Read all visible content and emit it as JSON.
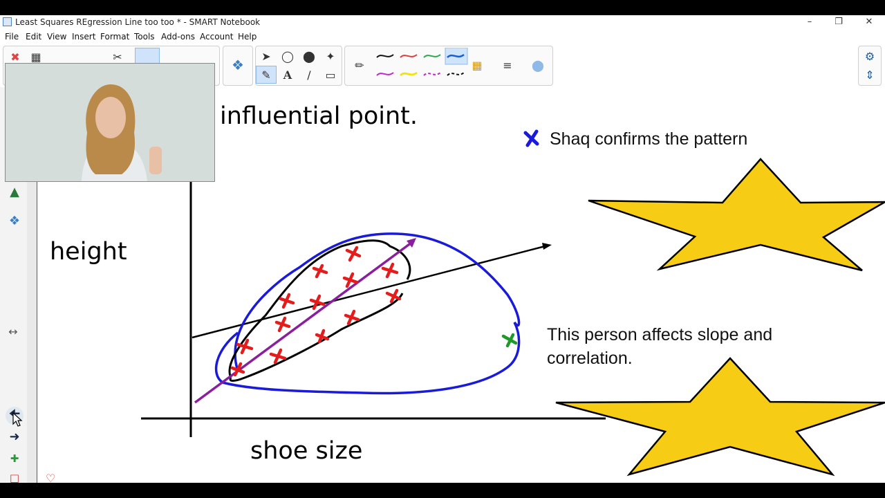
{
  "window": {
    "title": "Least Squares REgression Line  too too * - SMART Notebook",
    "controls": [
      "minimize",
      "restore",
      "close"
    ]
  },
  "menu": {
    "items": [
      "File",
      "Edit",
      "View",
      "Insert",
      "Format",
      "Tools",
      "Add-ons",
      "Account",
      "Help"
    ]
  },
  "toolbar": {
    "tools": [
      "select-icon",
      "shapes-icon",
      "fill-icon",
      "magic-pen-icon",
      "text-icon",
      "line-icon",
      "eraser-icon"
    ],
    "pen_colors": [
      "#111111",
      "#e03a3a",
      "#2aa84a",
      "#1a5fd0",
      "#c026c9",
      "#f2e21a",
      "#c026c9",
      "#111111"
    ],
    "right_icons": [
      "settings-icon",
      "move-toolbar-icon"
    ]
  },
  "sidebar": {
    "icons": [
      "gallery-icon",
      "addons-icon",
      "expand-icon",
      "back-arrow-icon",
      "forward-arrow-icon",
      "add-page-icon",
      "delete-page-icon"
    ]
  },
  "slide": {
    "heading": "influential point.",
    "y_label": "height",
    "x_label": "shoe size",
    "legend_text": "Shaq confirms the pattern",
    "note_text_line1": "This person affects slope and",
    "note_text_line2": "correlation.",
    "colors": {
      "marks": "#e51c1c",
      "outer_loop": "#1a1adb",
      "inner_loop": "#000000",
      "regression_line": "#8a1e9c",
      "shaq_mark": "#1a1adb",
      "outlier_mark": "#1f9a2a",
      "star_fill": "#f7cc14"
    }
  }
}
